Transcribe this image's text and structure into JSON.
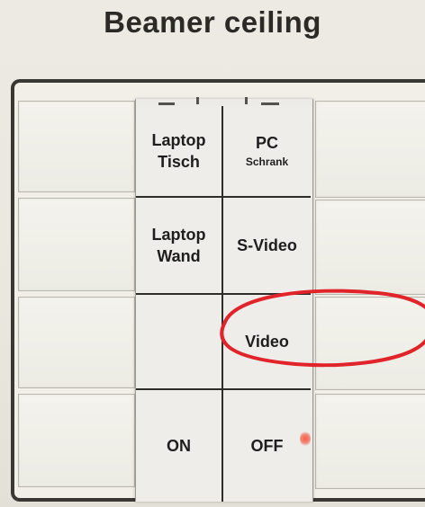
{
  "title": "Beamer ceiling",
  "buttons": {
    "laptop_tisch": {
      "line1": "Laptop",
      "line2": "Tisch"
    },
    "pc_schrank": {
      "line1": "PC",
      "line2": "Schrank"
    },
    "laptop_wand": {
      "line1": "Laptop",
      "line2": "Wand"
    },
    "s_video": {
      "label": "S-Video"
    },
    "blank": {
      "label": ""
    },
    "video": {
      "label": "Video"
    },
    "on": {
      "label": "ON"
    },
    "off": {
      "label": "OFF"
    }
  },
  "colors": {
    "annotation_circle": "#e0242a",
    "indicator_led": "#ff5a4a"
  },
  "highlighted_button": "Video",
  "off_indicator_lit": true
}
